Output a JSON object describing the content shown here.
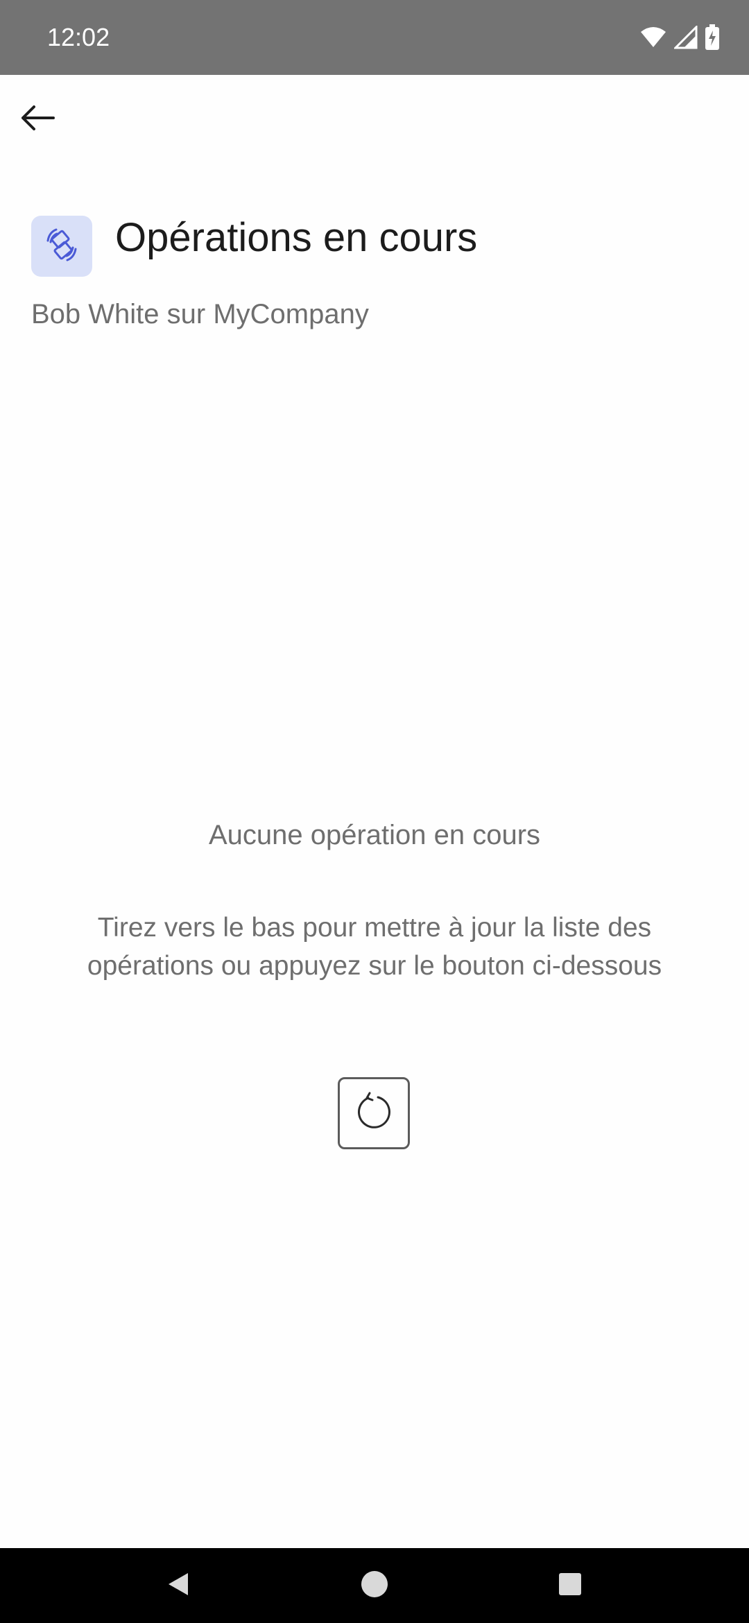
{
  "status_bar": {
    "time": "12:02",
    "icons": [
      "wifi-icon",
      "signal-icon",
      "battery-charging-icon"
    ]
  },
  "app_bar": {
    "back_icon": "arrow-left-icon"
  },
  "header": {
    "icon": "operations-icon",
    "title": "Opérations en cours",
    "subtitle": "Bob White sur MyCompany"
  },
  "empty_state": {
    "title": "Aucune opération en cours",
    "description": "Tirez vers le bas pour mettre à jour la liste des opérations ou appuyez sur le bouton ci-dessous",
    "refresh_icon": "refresh-icon"
  },
  "nav_bar": {
    "items": [
      "back-triangle-icon",
      "home-circle-icon",
      "recents-square-icon"
    ]
  },
  "colors": {
    "status_bar": "#737373",
    "icon_bg": "#d9e0f8",
    "icon_accent": "#4a5ad6",
    "text_primary": "#1c1c1c",
    "text_secondary": "#6e6e6e",
    "nav_bar": "#000000"
  }
}
